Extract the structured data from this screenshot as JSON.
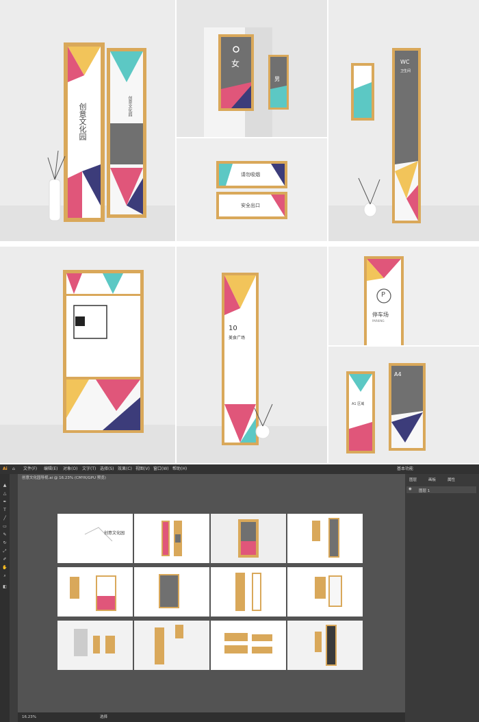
{
  "mockups": {
    "creative_banner_text": "创意文化园",
    "cultural_park_text": "创意文化园",
    "female_label": "女",
    "male_label": "男",
    "wc_label": "WC",
    "wc_subtitle": "卫生间",
    "direction_number": "A4",
    "exit_sign_1": "请勿吸烟",
    "exit_sign_2": "安全出口",
    "parking_label": "停车场",
    "parking_sub": "PARKING",
    "floor_number": "10",
    "floor_label": "美食广场",
    "a1_label": "A1 区域",
    "a4_label": "A4"
  },
  "app": {
    "logo": "Ai",
    "menu": [
      "文件(F)",
      "编辑(E)",
      "对象(O)",
      "文字(T)",
      "选择(S)",
      "效果(C)",
      "视图(V)",
      "窗口(W)",
      "帮助(H)"
    ],
    "workspace": "基本功能",
    "doc_tab": "创意文化园导视.ai @ 16.23% (CMYK/GPU 预览)",
    "panel_tabs": [
      "图层",
      "画板",
      "属性"
    ],
    "layer_name": "图层 1",
    "zoom": "16.23%",
    "status_label": "选择"
  },
  "colors": {
    "wood": "#d9a85a",
    "gray_panel": "#707070",
    "yellow": "#f2c45a",
    "pink": "#e0567a",
    "teal": "#5cc8c4",
    "navy": "#3c3c7a"
  }
}
